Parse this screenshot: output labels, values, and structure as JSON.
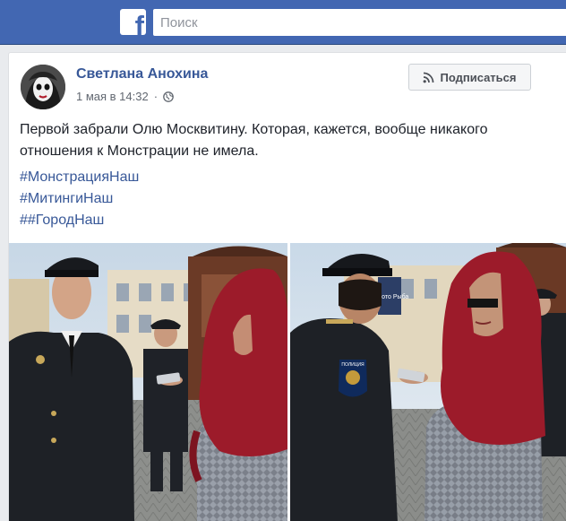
{
  "topbar": {
    "logo": "f",
    "search_placeholder": "Поиск"
  },
  "post": {
    "author": "Светлана Анохина",
    "date": "1 мая в 14:32",
    "separator": "·",
    "subscribe_label": "Подписаться",
    "text": "Первой забрали Олю Москвитину. Которая, кажется, вообще никакого отношения к Монстрации не имела.",
    "hashtags": [
      "#МонстрацияНаш",
      "#МитингиНаш",
      "##ГородНаш"
    ]
  },
  "photos": {
    "right": {
      "shop_sign": "Болото Рыба",
      "patch_text": "ПОЛИЦИЯ"
    }
  },
  "icons": {
    "globe": "globe-icon",
    "rss": "rss-icon",
    "logo": "facebook-logo-icon"
  },
  "colors": {
    "topbar": "#4267b2",
    "link": "#385898",
    "scarf": "#9c1b2a",
    "uniform": "#1e2126"
  }
}
